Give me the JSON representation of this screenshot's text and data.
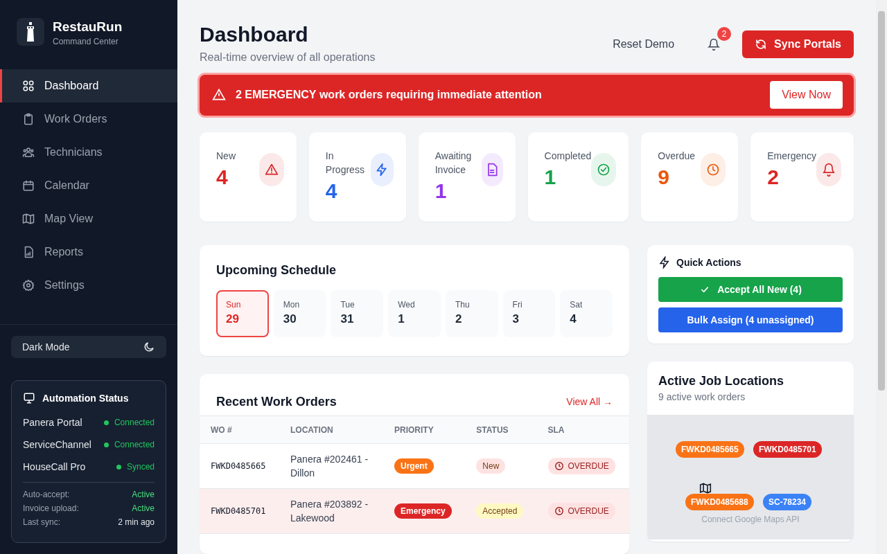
{
  "brand": {
    "name": "RestauRun",
    "tagline": "Command Center"
  },
  "nav": [
    {
      "label": "Dashboard",
      "selected": true
    },
    {
      "label": "Work Orders",
      "selected": false
    },
    {
      "label": "Technicians",
      "selected": false
    },
    {
      "label": "Calendar",
      "selected": false
    },
    {
      "label": "Map View",
      "selected": false
    },
    {
      "label": "Reports",
      "selected": false
    },
    {
      "label": "Settings",
      "selected": false
    }
  ],
  "dark_mode": {
    "label": "Dark Mode"
  },
  "automation": {
    "title": "Automation Status",
    "portals": [
      {
        "name": "Panera Portal",
        "status": "Connected",
        "color": "#22c55e"
      },
      {
        "name": "ServiceChannel",
        "status": "Connected",
        "color": "#22c55e"
      },
      {
        "name": "HouseCall Pro",
        "status": "Synced",
        "color": "#22c55e"
      }
    ],
    "details": [
      {
        "label": "Auto-accept:",
        "value": "Active",
        "kind": "ok"
      },
      {
        "label": "Invoice upload:",
        "value": "Active",
        "kind": "ok"
      },
      {
        "label": "Last sync:",
        "value": "2 min ago",
        "kind": "plain"
      }
    ]
  },
  "header": {
    "title": "Dashboard",
    "subtitle": "Real-time overview of all operations",
    "reset": "Reset Demo",
    "notifications": "2",
    "sync": "Sync Portals"
  },
  "alert": {
    "message": "**2 EMERGENCY** work orders requiring immediate attention",
    "action": "View Now"
  },
  "stats": [
    {
      "label": "New",
      "value": "4",
      "color": "#dc2626"
    },
    {
      "label": "In Progress",
      "value": "4",
      "color": "#2563eb"
    },
    {
      "label": "Awaiting Invoice",
      "value": "1",
      "color": "#9333ea"
    },
    {
      "label": "Completed",
      "value": "1",
      "color": "#16a34a"
    },
    {
      "label": "Overdue",
      "value": "9",
      "color": "#ea580c"
    },
    {
      "label": "Emergency",
      "value": "2",
      "color": "#dc2626"
    }
  ],
  "schedule": {
    "title": "Upcoming Schedule",
    "days": [
      {
        "day": "Sun",
        "date": "29",
        "selected": true
      },
      {
        "day": "Mon",
        "date": "30",
        "selected": false
      },
      {
        "day": "Tue",
        "date": "31",
        "selected": false
      },
      {
        "day": "Wed",
        "date": "1",
        "selected": false
      },
      {
        "day": "Thu",
        "date": "2",
        "selected": false
      },
      {
        "day": "Fri",
        "date": "3",
        "selected": false
      },
      {
        "day": "Sat",
        "date": "4",
        "selected": false
      }
    ]
  },
  "work_orders": {
    "title": "Recent Work Orders",
    "view_all": "View All →",
    "columns": [
      "WO #",
      "LOCATION",
      "PRIORITY",
      "STATUS",
      "SLA"
    ],
    "rows": [
      {
        "wo": "FWKD0485665",
        "location": "Panera #202461 - Dillon",
        "priority": {
          "label": "Urgent",
          "color": "#f97316"
        },
        "status": {
          "label": "New",
          "color": "#fee2e2"
        },
        "sla": "OVERDUE",
        "highlighted": false
      },
      {
        "wo": "FWKD0485701",
        "location": "Panera #203892 - Lakewood",
        "priority": {
          "label": "Emergency",
          "color": "#dc2626"
        },
        "status": {
          "label": "Accepted",
          "color": "#fef9c3"
        },
        "sla": "OVERDUE",
        "highlighted": true
      }
    ]
  },
  "quick_actions": {
    "title": "Quick Actions",
    "buttons": [
      {
        "label": "Accept All New (4)",
        "kind": "accept"
      },
      {
        "label": "Bulk Assign (4 unassigned)",
        "kind": "assign"
      }
    ]
  },
  "locations": {
    "title": "Active Job Locations",
    "subtitle": "9 active work orders",
    "hint": "Connect Google Maps API",
    "pins": [
      {
        "label": "FWKD0485665",
        "color": "#f97316"
      },
      {
        "label": "FWKD0485701",
        "color": "#dc2626"
      },
      {
        "label": "FWKD0485688",
        "color": "#f97316"
      },
      {
        "label": "SC-78234",
        "color": "#3b82f6"
      }
    ]
  }
}
